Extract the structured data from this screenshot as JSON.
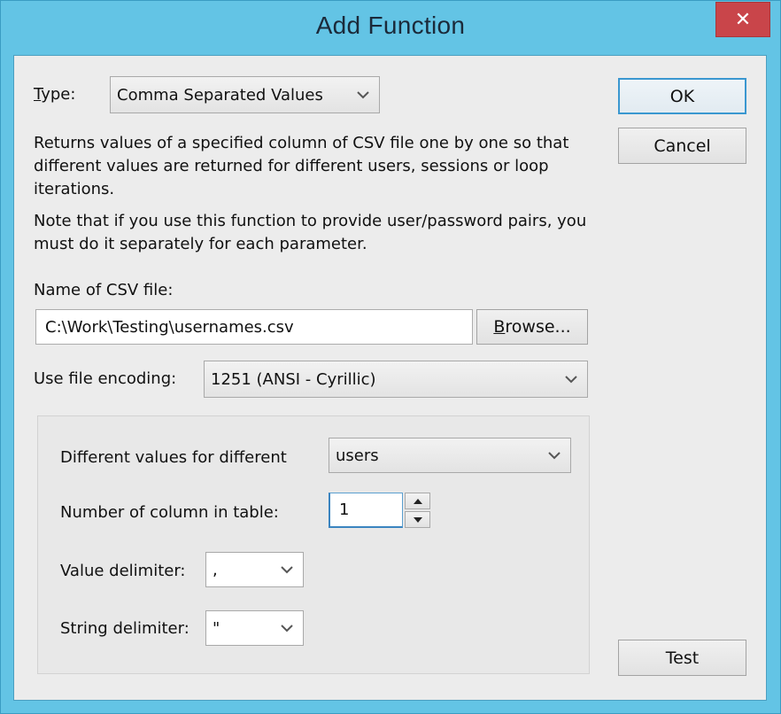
{
  "window": {
    "title": "Add Function",
    "close_label": "✕",
    "titlebar_color": "#63c4e5",
    "close_color": "#c9454a"
  },
  "type": {
    "label_underlined": "T",
    "label_rest": "ype:",
    "value": "Comma Separated Values"
  },
  "description": {
    "line1": "Returns values of a specified column of CSV file one by one so that different values are returned for different users, sessions or loop iterations.",
    "line2": "Note that if you use this function to provide user/password pairs, you must do it separately for each parameter."
  },
  "csv_file": {
    "label": "Name of CSV file:",
    "value": "C:\\Work\\Testing\\usernames.csv",
    "browse_underlined": "B",
    "browse_rest": "rowse..."
  },
  "encoding": {
    "label": "Use file encoding:",
    "value": "1251  (ANSI - Cyrillic)"
  },
  "options": {
    "different_values_label": "Different values for different",
    "different_values_value": "users",
    "column_label": "Number of column in table:",
    "column_value": "1",
    "value_delimiter_label": "Value delimiter:",
    "value_delimiter_value": ",",
    "string_delimiter_label": "String delimiter:",
    "string_delimiter_value": "\""
  },
  "buttons": {
    "ok": "OK",
    "cancel": "Cancel",
    "test": "Test"
  },
  "icons": {
    "chevron": "chevron-down-icon",
    "spin_up": "triangle-up-icon",
    "spin_down": "triangle-down-icon",
    "close": "close-icon"
  }
}
